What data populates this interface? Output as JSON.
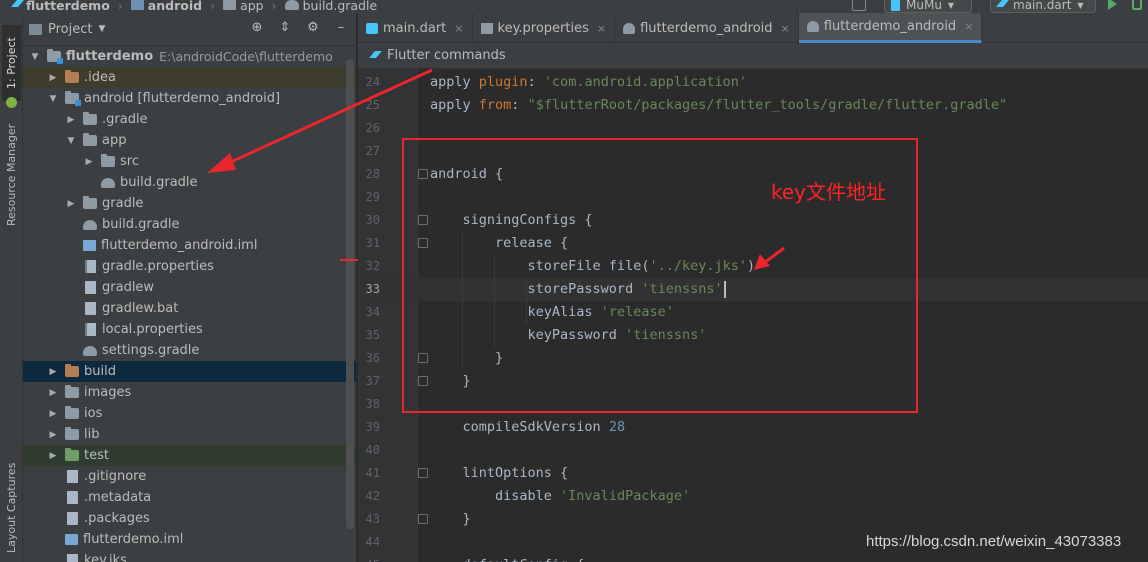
{
  "breadcrumb": {
    "items": [
      "flutterdemo",
      "android",
      "app",
      "build.gradle"
    ]
  },
  "toolbar": {
    "device": "MuMu",
    "run_config": "main.dart"
  },
  "left_strip": {
    "project_tab": "1: Project",
    "resource_tab": "Resource Manager",
    "layout_tab": "Layout Captures"
  },
  "project_panel": {
    "title": "Project",
    "tree": [
      {
        "label": "flutterdemo",
        "path": "E:\\androidCode\\flutterdemo",
        "depth": 0,
        "expanded": true,
        "icon": "module-folder-icon",
        "bold": true
      },
      {
        "label": ".idea",
        "depth": 1,
        "expanded": false,
        "icon": "excluded-folder-icon",
        "highlight": "yellow"
      },
      {
        "label": "android [flutterdemo_android]",
        "depth": 1,
        "expanded": true,
        "icon": "module-folder-icon"
      },
      {
        "label": ".gradle",
        "depth": 2,
        "expanded": false,
        "icon": "folder-icon"
      },
      {
        "label": "app",
        "depth": 2,
        "expanded": true,
        "icon": "folder-icon"
      },
      {
        "label": "src",
        "depth": 3,
        "expanded": false,
        "icon": "folder-icon"
      },
      {
        "label": "build.gradle",
        "depth": 3,
        "icon": "gradle-icon"
      },
      {
        "label": "gradle",
        "depth": 2,
        "expanded": false,
        "icon": "folder-icon"
      },
      {
        "label": "build.gradle",
        "depth": 2,
        "icon": "gradle-icon"
      },
      {
        "label": "flutterdemo_android.iml",
        "depth": 2,
        "icon": "iml-file-icon"
      },
      {
        "label": "gradle.properties",
        "depth": 2,
        "icon": "properties-file-icon"
      },
      {
        "label": "gradlew",
        "depth": 2,
        "icon": "file-icon"
      },
      {
        "label": "gradlew.bat",
        "depth": 2,
        "icon": "file-icon"
      },
      {
        "label": "local.properties",
        "depth": 2,
        "icon": "properties-file-icon"
      },
      {
        "label": "settings.gradle",
        "depth": 2,
        "icon": "gradle-icon"
      },
      {
        "label": "build",
        "depth": 1,
        "expanded": false,
        "icon": "excluded-folder-icon",
        "highlight": "blue"
      },
      {
        "label": "images",
        "depth": 1,
        "expanded": false,
        "icon": "folder-icon"
      },
      {
        "label": "ios",
        "depth": 1,
        "expanded": false,
        "icon": "folder-icon"
      },
      {
        "label": "lib",
        "depth": 1,
        "expanded": false,
        "icon": "folder-icon"
      },
      {
        "label": "test",
        "depth": 1,
        "expanded": false,
        "icon": "test-folder-icon",
        "highlight": "green"
      },
      {
        "label": ".gitignore",
        "depth": 1,
        "icon": "gitignore-file-icon"
      },
      {
        "label": ".metadata",
        "depth": 1,
        "icon": "file-icon"
      },
      {
        "label": ".packages",
        "depth": 1,
        "icon": "file-icon"
      },
      {
        "label": "flutterdemo.iml",
        "depth": 1,
        "icon": "iml-file-icon"
      },
      {
        "label": "key.jks",
        "depth": 1,
        "icon": "jks-file-icon"
      }
    ]
  },
  "tabs": [
    {
      "label": "main.dart",
      "icon": "dart-file-icon",
      "active": false
    },
    {
      "label": "key.properties",
      "icon": "properties-file-icon",
      "active": false
    },
    {
      "label": "flutterdemo_android",
      "icon": "gradle-icon",
      "active": false
    },
    {
      "label": "flutterdemo_android",
      "icon": "gradle-icon",
      "active": true
    }
  ],
  "flutter_commands": "Flutter commands",
  "editor": {
    "current_line": 33,
    "lines": [
      {
        "n": "24",
        "tokens": [
          [
            "t",
            "apply "
          ],
          [
            "k",
            "plugin"
          ],
          [
            "t",
            ": "
          ],
          [
            "s",
            "'com.android.application'"
          ]
        ]
      },
      {
        "n": "25",
        "tokens": [
          [
            "t",
            "apply "
          ],
          [
            "k",
            "from"
          ],
          [
            "t",
            ": "
          ],
          [
            "s",
            "\"$flutterRoot/packages/flutter_tools/gradle/flutter.gradle\""
          ]
        ]
      },
      {
        "n": "26",
        "tokens": []
      },
      {
        "n": "27",
        "tokens": []
      },
      {
        "n": "28",
        "tokens": [
          [
            "t",
            "android {"
          ]
        ]
      },
      {
        "n": "29",
        "tokens": []
      },
      {
        "n": "30",
        "tokens": [
          [
            "t",
            "    signingConfigs {"
          ]
        ]
      },
      {
        "n": "31",
        "tokens": [
          [
            "t",
            "        release {"
          ]
        ]
      },
      {
        "n": "32",
        "tokens": [
          [
            "t",
            "            storeFile file("
          ],
          [
            "s",
            "'../key.jks'"
          ],
          [
            "t",
            ")"
          ]
        ]
      },
      {
        "n": "33",
        "tokens": [
          [
            "t",
            "            storePassword "
          ],
          [
            "s",
            "'tienssns'"
          ]
        ]
      },
      {
        "n": "34",
        "tokens": [
          [
            "t",
            "            keyAlias "
          ],
          [
            "s",
            "'release'"
          ]
        ]
      },
      {
        "n": "35",
        "tokens": [
          [
            "t",
            "            keyPassword "
          ],
          [
            "s",
            "'tienssns'"
          ]
        ]
      },
      {
        "n": "36",
        "tokens": [
          [
            "t",
            "        }"
          ]
        ]
      },
      {
        "n": "37",
        "tokens": [
          [
            "t",
            "    }"
          ]
        ]
      },
      {
        "n": "38",
        "tokens": []
      },
      {
        "n": "39",
        "tokens": [
          [
            "t",
            "    compileSdkVersion "
          ],
          [
            "num",
            "28"
          ]
        ]
      },
      {
        "n": "40",
        "tokens": []
      },
      {
        "n": "41",
        "tokens": [
          [
            "t",
            "    lintOptions {"
          ]
        ]
      },
      {
        "n": "42",
        "tokens": [
          [
            "t",
            "        disable "
          ],
          [
            "s",
            "'InvalidPackage'"
          ]
        ]
      },
      {
        "n": "43",
        "tokens": [
          [
            "t",
            "    }"
          ]
        ]
      },
      {
        "n": "44",
        "tokens": []
      },
      {
        "n": "45",
        "tokens": [
          [
            "t",
            "    defaultConfig {"
          ]
        ]
      }
    ]
  },
  "annotation": "key文件地址",
  "watermark": "https://blog.csdn.net/weixin_43073383",
  "colors": {
    "annotation_red": "#e9252d",
    "keyword": "#cc7832",
    "string": "#6a8759",
    "number": "#6897bb"
  }
}
